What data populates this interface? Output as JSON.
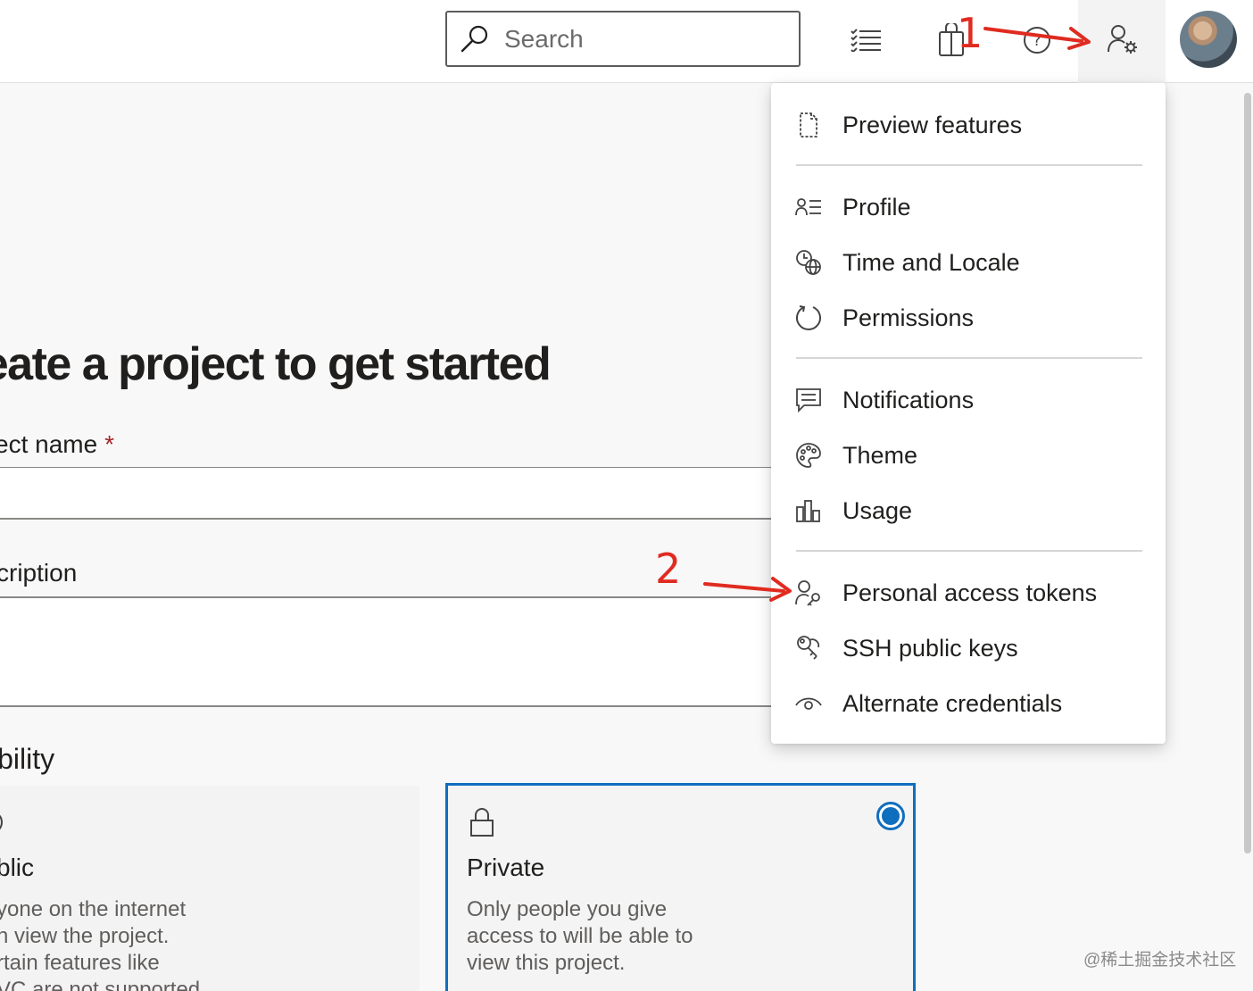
{
  "header": {
    "search_placeholder": "Search",
    "icons": [
      "search-icon",
      "work-items-icon",
      "marketplace-icon",
      "help-icon",
      "user-settings-icon",
      "avatar"
    ]
  },
  "main": {
    "heading": "reate a project to get started",
    "project_name_label": "ect name",
    "required_marker": "*",
    "description_label": "cription",
    "visibility_label": "ibility",
    "public_card": {
      "title": "blic",
      "desc_lines": [
        "yone on the internet",
        "n view the project.",
        "rtain features like",
        "VC are not supported"
      ]
    },
    "private_card": {
      "title": "Private",
      "desc_lines": [
        "Only people you give",
        "access to will be able to",
        "view this project."
      ],
      "selected": true
    }
  },
  "user_menu": {
    "items": [
      {
        "label": "Preview features",
        "icon": "preview-features-icon"
      },
      {
        "label": "Profile",
        "icon": "profile-icon"
      },
      {
        "label": "Time and Locale",
        "icon": "time-locale-icon"
      },
      {
        "label": "Permissions",
        "icon": "permissions-icon"
      },
      {
        "label": "Notifications",
        "icon": "notifications-icon"
      },
      {
        "label": "Theme",
        "icon": "theme-icon"
      },
      {
        "label": "Usage",
        "icon": "usage-icon"
      },
      {
        "label": "Personal access tokens",
        "icon": "personal-access-tokens-icon"
      },
      {
        "label": "SSH public keys",
        "icon": "ssh-keys-icon"
      },
      {
        "label": "Alternate credentials",
        "icon": "alternate-credentials-icon"
      }
    ]
  },
  "annotations": {
    "step1": "1",
    "step2": "2",
    "color": "#e02b20"
  },
  "watermark": "@稀土掘金技术社区",
  "colors": {
    "accent": "#106ebe",
    "required": "#a4262c"
  }
}
